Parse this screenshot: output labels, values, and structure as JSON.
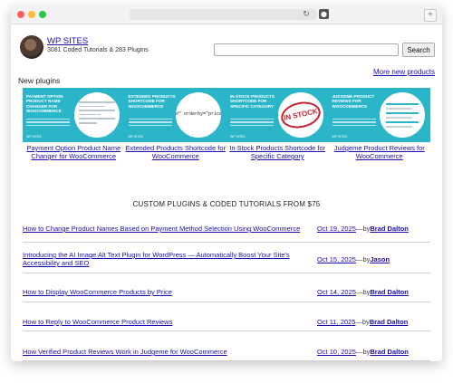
{
  "browser": {
    "reload_glyph": "↻",
    "ext_glyph": "●",
    "newtab_glyph": "+"
  },
  "header": {
    "site_name": "WP SITES",
    "tagline": "3081 Coded Tutorials & 283 Plugins",
    "search_placeholder": "",
    "search_button": "Search"
  },
  "new_plugins": {
    "label": "New plugins",
    "more_link": "More new products",
    "banner_color": "#2bb5c9",
    "tiles": [
      {
        "title": "PAYMENT OPTION PRODUCT NAME CHANGER FOR WOOCOMMERCE",
        "caption": "Payment Option Product Name Changer for WooCommerce",
        "logo": "WP SITES"
      },
      {
        "title": "EXTENDED PRODUCTS SHORTCODE FOR WOOCOMMERCE",
        "caption": "Extended Products Shortcode for WooCommerce",
        "logo": "WP SITES",
        "code": "#\" orderby=\"price\" or"
      },
      {
        "title": "IN STOCK PRODUCTS SHORTCODE FOR SPECIFIC CATEGORY",
        "caption": "In Stock Products Shortcode for Specific Category",
        "logo": "WP SITES",
        "stamp": "IN STOCK"
      },
      {
        "title": "JUDGEME PRODUCT REVIEWS FOR WOOCOMMERCE",
        "caption": "Judgeme Product Reviews for WooCommerce",
        "logo": "WP SITES"
      }
    ]
  },
  "posts_heading": "CUSTOM PLUGINS & CODED TUTORIALS FROM $75",
  "posts": [
    {
      "title": "How to Change Product Names Based on Payment Method Selection Using WooCommerce",
      "date": "Oct 19, 2025",
      "sep": "—by",
      "author": "Brad Dalton"
    },
    {
      "title": "Introducing the AI Image Alt Text Plugin for WordPress — Automatically Boost Your Site's Accessibility and SEO",
      "date": "Oct 15, 2025",
      "sep": "—by",
      "author": "Jason"
    },
    {
      "title": "How to Display WooCommerce Products by Price",
      "date": "Oct 14, 2025",
      "sep": "—by",
      "author": "Brad Dalton"
    },
    {
      "title": "How to Reply to WooCommerce Product Reviews",
      "date": "Oct 11, 2025",
      "sep": "—by",
      "author": "Brad Dalton"
    },
    {
      "title": "How Verified Product Reviews Work in Judgeme for WooCommerce",
      "date": "Oct 10, 2025",
      "sep": "—by",
      "author": "Brad Dalton"
    }
  ]
}
